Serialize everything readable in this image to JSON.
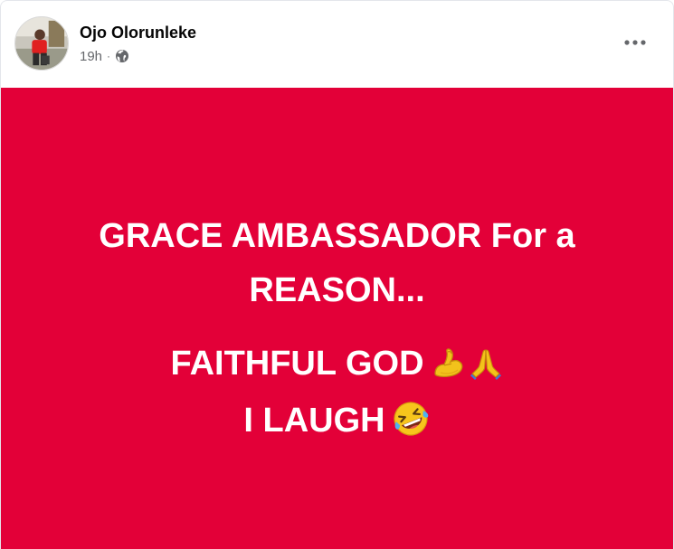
{
  "post": {
    "author": "Ojo Olorunleke",
    "time": "19h",
    "separator": "·",
    "audience_icon": "globe-icon",
    "more_icon": "more-options-icon",
    "background_color": "#e30038",
    "text_color": "#ffffff",
    "body": {
      "line1": "GRACE AMBASSADOR For a",
      "line2": "REASON...",
      "line3": "FAITHFUL GOD",
      "line3_emojis": [
        "flexed-biceps-emoji",
        "folded-hands-emoji"
      ],
      "line4": "I LAUGH",
      "line4_emojis": [
        "rolling-on-floor-laughing-emoji"
      ]
    }
  }
}
